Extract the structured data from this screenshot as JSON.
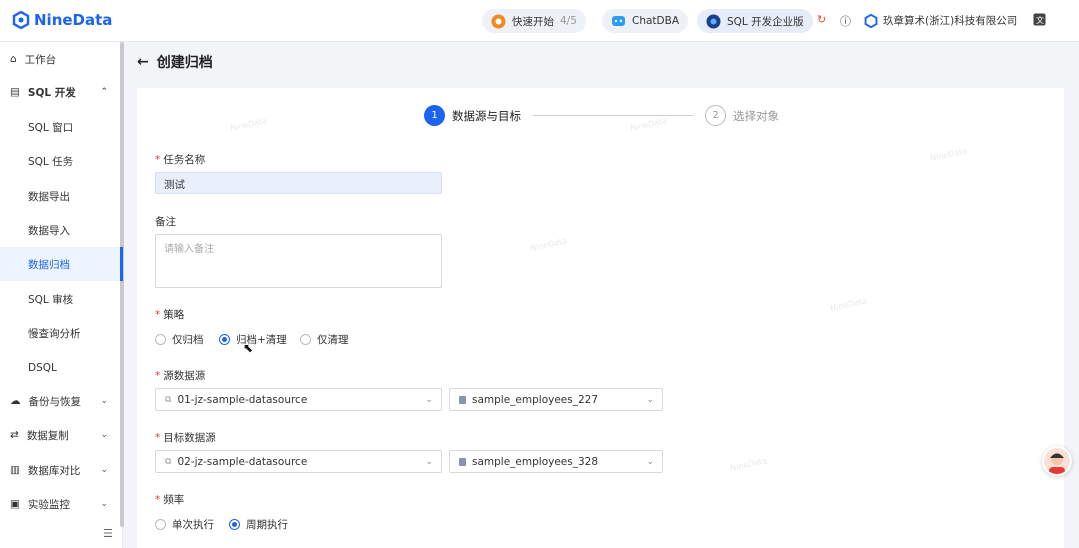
{
  "app": {
    "logo_text": "NineData"
  },
  "topbar": {
    "quickstart_label": "快速开始",
    "quickstart_progress": "4/5",
    "chatdba_label": "ChatDBA",
    "edition_label": "SQL 开发企业版",
    "company_name": "玖章算术(浙江)科技有限公司"
  },
  "sidebar": {
    "items": [
      {
        "label": "工作台",
        "icon": "home-icon"
      },
      {
        "label": "SQL 开发",
        "icon": "sql-dev-icon",
        "expanded": true
      },
      {
        "label": "SQL 窗口"
      },
      {
        "label": "SQL 任务"
      },
      {
        "label": "数据导出"
      },
      {
        "label": "数据导入"
      },
      {
        "label": "数据归档",
        "active": true
      },
      {
        "label": "SQL 审核"
      },
      {
        "label": "慢查询分析"
      },
      {
        "label": "DSQL"
      },
      {
        "label": "备份与恢复",
        "icon": "backup-icon"
      },
      {
        "label": "数据复制",
        "icon": "replication-icon"
      },
      {
        "label": "数据库对比",
        "icon": "compare-icon"
      },
      {
        "label": "实验监控",
        "icon": "monitor-icon"
      }
    ]
  },
  "page": {
    "title": "创建归档",
    "back_icon": "arrow-left-icon"
  },
  "steps": [
    {
      "number": "1",
      "label": "数据源与目标",
      "active": true
    },
    {
      "number": "2",
      "label": "选择对象",
      "active": false
    }
  ],
  "form": {
    "task_name_label": "任务名称",
    "task_name_value": "测试",
    "remark_label": "备注",
    "remark_placeholder": "请输入备注",
    "strategy_label": "策略",
    "strategy_options": [
      "仅归档",
      "归档+清理",
      "仅清理"
    ],
    "strategy_selected": "归档+清理",
    "source_label": "源数据源",
    "source_datasource": "01-jz-sample-datasource",
    "source_database": "sample_employees_227",
    "target_label": "目标数据源",
    "target_datasource": "02-jz-sample-datasource",
    "target_database": "sample_employees_328",
    "frequency_label": "频率",
    "frequency_options": [
      "单次执行",
      "周期执行"
    ],
    "frequency_selected": "周期执行"
  },
  "colors": {
    "accent": "#1b64f2",
    "required": "#e53935"
  }
}
